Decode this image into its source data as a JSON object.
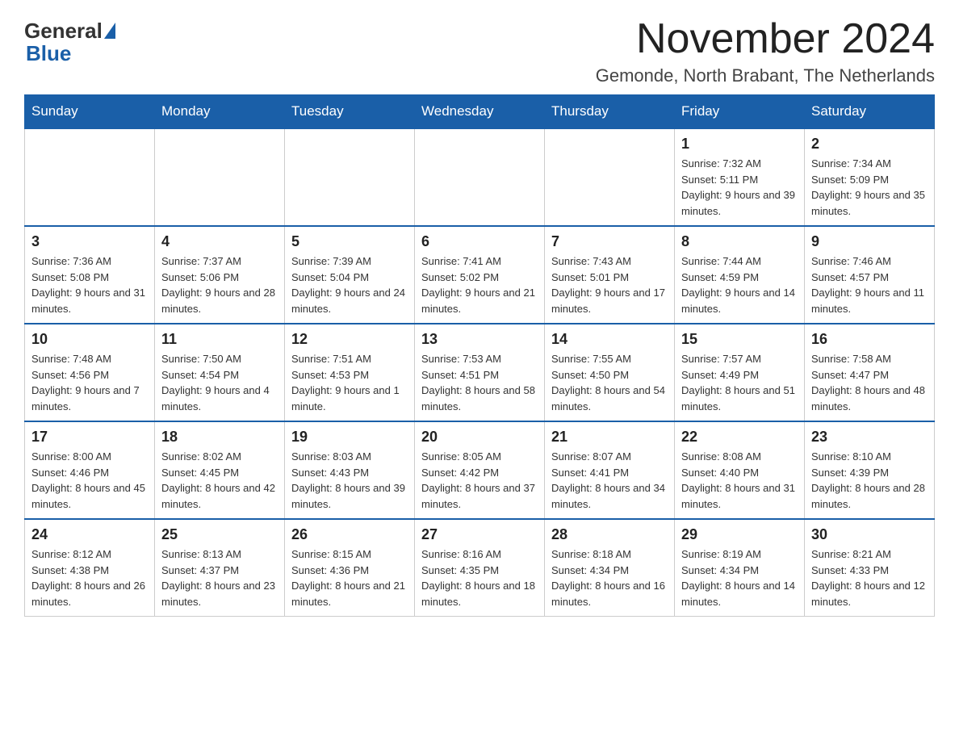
{
  "logo": {
    "general": "General",
    "blue": "Blue"
  },
  "title": {
    "month": "November 2024",
    "location": "Gemonde, North Brabant, The Netherlands"
  },
  "weekdays": [
    "Sunday",
    "Monday",
    "Tuesday",
    "Wednesday",
    "Thursday",
    "Friday",
    "Saturday"
  ],
  "weeks": [
    [
      {
        "day": "",
        "info": ""
      },
      {
        "day": "",
        "info": ""
      },
      {
        "day": "",
        "info": ""
      },
      {
        "day": "",
        "info": ""
      },
      {
        "day": "",
        "info": ""
      },
      {
        "day": "1",
        "info": "Sunrise: 7:32 AM\nSunset: 5:11 PM\nDaylight: 9 hours and 39 minutes."
      },
      {
        "day": "2",
        "info": "Sunrise: 7:34 AM\nSunset: 5:09 PM\nDaylight: 9 hours and 35 minutes."
      }
    ],
    [
      {
        "day": "3",
        "info": "Sunrise: 7:36 AM\nSunset: 5:08 PM\nDaylight: 9 hours and 31 minutes."
      },
      {
        "day": "4",
        "info": "Sunrise: 7:37 AM\nSunset: 5:06 PM\nDaylight: 9 hours and 28 minutes."
      },
      {
        "day": "5",
        "info": "Sunrise: 7:39 AM\nSunset: 5:04 PM\nDaylight: 9 hours and 24 minutes."
      },
      {
        "day": "6",
        "info": "Sunrise: 7:41 AM\nSunset: 5:02 PM\nDaylight: 9 hours and 21 minutes."
      },
      {
        "day": "7",
        "info": "Sunrise: 7:43 AM\nSunset: 5:01 PM\nDaylight: 9 hours and 17 minutes."
      },
      {
        "day": "8",
        "info": "Sunrise: 7:44 AM\nSunset: 4:59 PM\nDaylight: 9 hours and 14 minutes."
      },
      {
        "day": "9",
        "info": "Sunrise: 7:46 AM\nSunset: 4:57 PM\nDaylight: 9 hours and 11 minutes."
      }
    ],
    [
      {
        "day": "10",
        "info": "Sunrise: 7:48 AM\nSunset: 4:56 PM\nDaylight: 9 hours and 7 minutes."
      },
      {
        "day": "11",
        "info": "Sunrise: 7:50 AM\nSunset: 4:54 PM\nDaylight: 9 hours and 4 minutes."
      },
      {
        "day": "12",
        "info": "Sunrise: 7:51 AM\nSunset: 4:53 PM\nDaylight: 9 hours and 1 minute."
      },
      {
        "day": "13",
        "info": "Sunrise: 7:53 AM\nSunset: 4:51 PM\nDaylight: 8 hours and 58 minutes."
      },
      {
        "day": "14",
        "info": "Sunrise: 7:55 AM\nSunset: 4:50 PM\nDaylight: 8 hours and 54 minutes."
      },
      {
        "day": "15",
        "info": "Sunrise: 7:57 AM\nSunset: 4:49 PM\nDaylight: 8 hours and 51 minutes."
      },
      {
        "day": "16",
        "info": "Sunrise: 7:58 AM\nSunset: 4:47 PM\nDaylight: 8 hours and 48 minutes."
      }
    ],
    [
      {
        "day": "17",
        "info": "Sunrise: 8:00 AM\nSunset: 4:46 PM\nDaylight: 8 hours and 45 minutes."
      },
      {
        "day": "18",
        "info": "Sunrise: 8:02 AM\nSunset: 4:45 PM\nDaylight: 8 hours and 42 minutes."
      },
      {
        "day": "19",
        "info": "Sunrise: 8:03 AM\nSunset: 4:43 PM\nDaylight: 8 hours and 39 minutes."
      },
      {
        "day": "20",
        "info": "Sunrise: 8:05 AM\nSunset: 4:42 PM\nDaylight: 8 hours and 37 minutes."
      },
      {
        "day": "21",
        "info": "Sunrise: 8:07 AM\nSunset: 4:41 PM\nDaylight: 8 hours and 34 minutes."
      },
      {
        "day": "22",
        "info": "Sunrise: 8:08 AM\nSunset: 4:40 PM\nDaylight: 8 hours and 31 minutes."
      },
      {
        "day": "23",
        "info": "Sunrise: 8:10 AM\nSunset: 4:39 PM\nDaylight: 8 hours and 28 minutes."
      }
    ],
    [
      {
        "day": "24",
        "info": "Sunrise: 8:12 AM\nSunset: 4:38 PM\nDaylight: 8 hours and 26 minutes."
      },
      {
        "day": "25",
        "info": "Sunrise: 8:13 AM\nSunset: 4:37 PM\nDaylight: 8 hours and 23 minutes."
      },
      {
        "day": "26",
        "info": "Sunrise: 8:15 AM\nSunset: 4:36 PM\nDaylight: 8 hours and 21 minutes."
      },
      {
        "day": "27",
        "info": "Sunrise: 8:16 AM\nSunset: 4:35 PM\nDaylight: 8 hours and 18 minutes."
      },
      {
        "day": "28",
        "info": "Sunrise: 8:18 AM\nSunset: 4:34 PM\nDaylight: 8 hours and 16 minutes."
      },
      {
        "day": "29",
        "info": "Sunrise: 8:19 AM\nSunset: 4:34 PM\nDaylight: 8 hours and 14 minutes."
      },
      {
        "day": "30",
        "info": "Sunrise: 8:21 AM\nSunset: 4:33 PM\nDaylight: 8 hours and 12 minutes."
      }
    ]
  ]
}
